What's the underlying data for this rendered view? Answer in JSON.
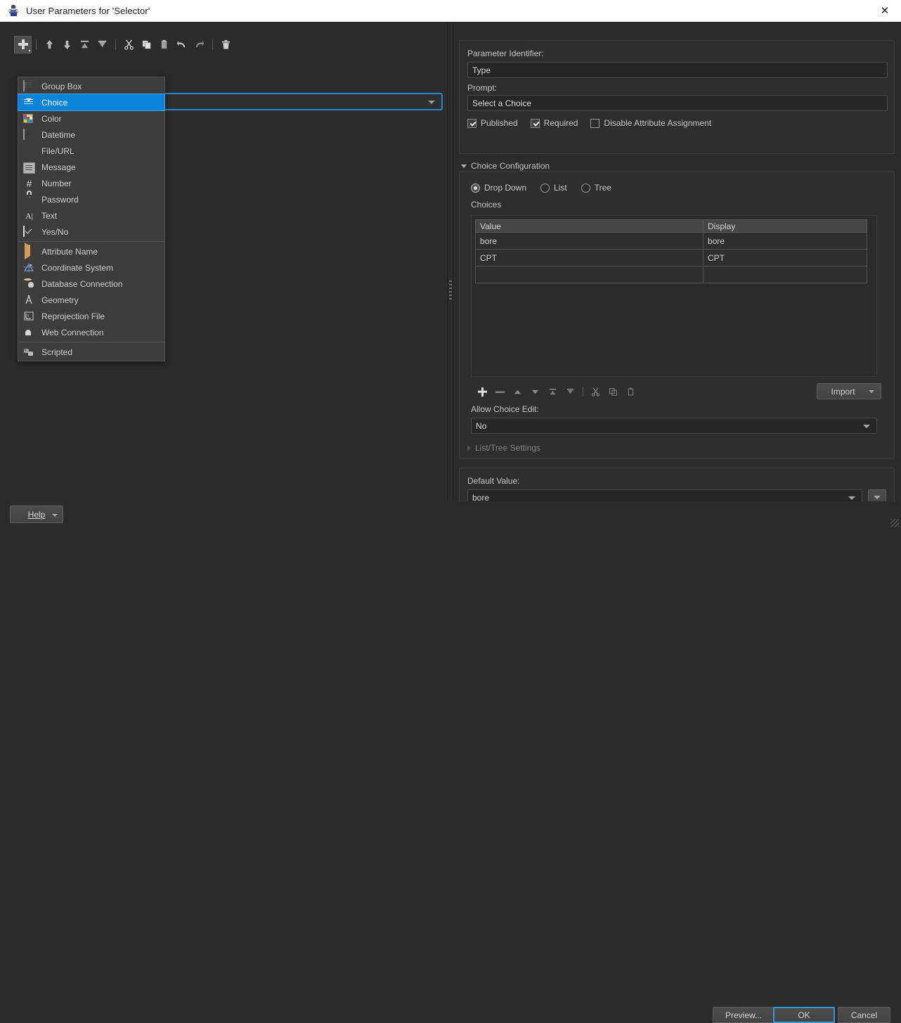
{
  "window": {
    "title": "User Parameters for 'Selector'",
    "app_icon": "fme-workbench-icon",
    "close_icon": "close-icon"
  },
  "toolbar": {
    "buttons": [
      {
        "name": "add",
        "icon": "plus-icon",
        "active": true
      },
      {
        "name": "move-up",
        "icon": "arrow-up-icon"
      },
      {
        "name": "move-down",
        "icon": "arrow-down-icon"
      },
      {
        "name": "move-to-top",
        "icon": "arrow-to-top-icon"
      },
      {
        "name": "move-to-bottom",
        "icon": "arrow-to-bottom-icon"
      },
      {
        "name": "cut",
        "icon": "scissors-icon"
      },
      {
        "name": "copy",
        "icon": "copy-icon"
      },
      {
        "name": "paste",
        "icon": "clipboard-icon"
      },
      {
        "name": "undo",
        "icon": "undo-arrow-icon"
      },
      {
        "name": "redo",
        "icon": "redo-arrow-icon"
      },
      {
        "name": "delete",
        "icon": "trash-icon"
      }
    ]
  },
  "menu": {
    "items": [
      {
        "label": "Group Box",
        "icon": "group-box-icon",
        "selected": false
      },
      {
        "label": "Choice",
        "icon": "choice-icon",
        "selected": true
      },
      {
        "label": "Color",
        "icon": "color-swatch-icon",
        "selected": false
      },
      {
        "label": "Datetime",
        "icon": "calendar-icon",
        "selected": false
      },
      {
        "label": "File/URL",
        "icon": "file-icon",
        "selected": false
      },
      {
        "label": "Message",
        "icon": "message-icon",
        "selected": false
      },
      {
        "label": "Number",
        "icon": "hash-icon",
        "selected": false
      },
      {
        "label": "Password",
        "icon": "lock-icon",
        "selected": false
      },
      {
        "label": "Text",
        "icon": "text-cursor-icon",
        "selected": false
      },
      {
        "label": "Yes/No",
        "icon": "checkbox-icon",
        "selected": false
      },
      {
        "label": "Attribute Name",
        "icon": "attribute-arrow-icon",
        "selected": false
      },
      {
        "label": "Coordinate System",
        "icon": "coordinate-system-icon",
        "selected": false
      },
      {
        "label": "Database Connection",
        "icon": "database-icon",
        "selected": false
      },
      {
        "label": "Geometry",
        "icon": "compass-icon",
        "selected": false
      },
      {
        "label": "Reprojection File",
        "icon": "reprojection-icon",
        "selected": false
      },
      {
        "label": "Web Connection",
        "icon": "globe-icon",
        "selected": false
      },
      {
        "label": "Scripted",
        "icon": "script-icon",
        "selected": false
      }
    ]
  },
  "left_pane": {
    "parameter_combo_value": "",
    "parameter_combo_caret_icon": "chevron-down-icon"
  },
  "properties": {
    "parameter_identifier_label": "Parameter Identifier:",
    "parameter_identifier_value": "Type",
    "prompt_label": "Prompt:",
    "prompt_value": "Select a Choice",
    "checkboxes": [
      {
        "label": "Published",
        "checked": true
      },
      {
        "label": "Required",
        "checked": true
      },
      {
        "label": "Disable Attribute Assignment",
        "checked": false
      }
    ]
  },
  "choice_configuration": {
    "section_title": "Choice Configuration",
    "section_expanded": true,
    "mode_options": [
      {
        "label": "Drop Down",
        "selected": true
      },
      {
        "label": "List",
        "selected": false
      },
      {
        "label": "Tree",
        "selected": false
      }
    ],
    "choices_label": "Choices",
    "table": {
      "columns": [
        "Value",
        "Display"
      ],
      "rows": [
        {
          "value": "bore",
          "display": "bore"
        },
        {
          "value": "CPT",
          "display": "CPT"
        },
        {
          "value": "",
          "display": ""
        }
      ]
    },
    "row_toolbar": [
      {
        "name": "add-row",
        "icon": "plus-icon"
      },
      {
        "name": "remove-row",
        "icon": "minus-icon"
      },
      {
        "name": "move-row-up",
        "icon": "triangle-up-icon"
      },
      {
        "name": "move-row-down",
        "icon": "triangle-down-icon"
      },
      {
        "name": "move-row-to-top",
        "icon": "triangle-to-top-icon"
      },
      {
        "name": "move-row-to-bottom",
        "icon": "triangle-to-bottom-icon"
      },
      {
        "name": "cut-row",
        "icon": "scissors-icon"
      },
      {
        "name": "copy-row",
        "icon": "copy-icon"
      },
      {
        "name": "paste-row",
        "icon": "clipboard-icon"
      }
    ],
    "import_button": "Import",
    "import_caret_icon": "chevron-down-icon",
    "allow_choice_edit_label": "Allow Choice Edit:",
    "allow_choice_edit_value": "No",
    "allow_choice_edit_caret_icon": "chevron-down-icon",
    "list_tree_settings_label": "List/Tree Settings",
    "list_tree_settings_expanded": false
  },
  "default_value": {
    "label": "Default Value:",
    "value": "bore",
    "caret_icon": "chevron-down-icon",
    "extra_button_icon": "chevron-down-icon"
  },
  "footer": {
    "help_label": "Help",
    "help_caret_icon": "chevron-down-icon",
    "preview_label": "Preview...",
    "ok_label": "OK",
    "cancel_label": "Cancel"
  },
  "colors": {
    "accent": "#0a84d8",
    "focus_border": "#2f9ae0",
    "window_bg": "#2b2b2b",
    "panel_bg": "#2e2e2e",
    "titlebar_bg": "#ffffff"
  }
}
